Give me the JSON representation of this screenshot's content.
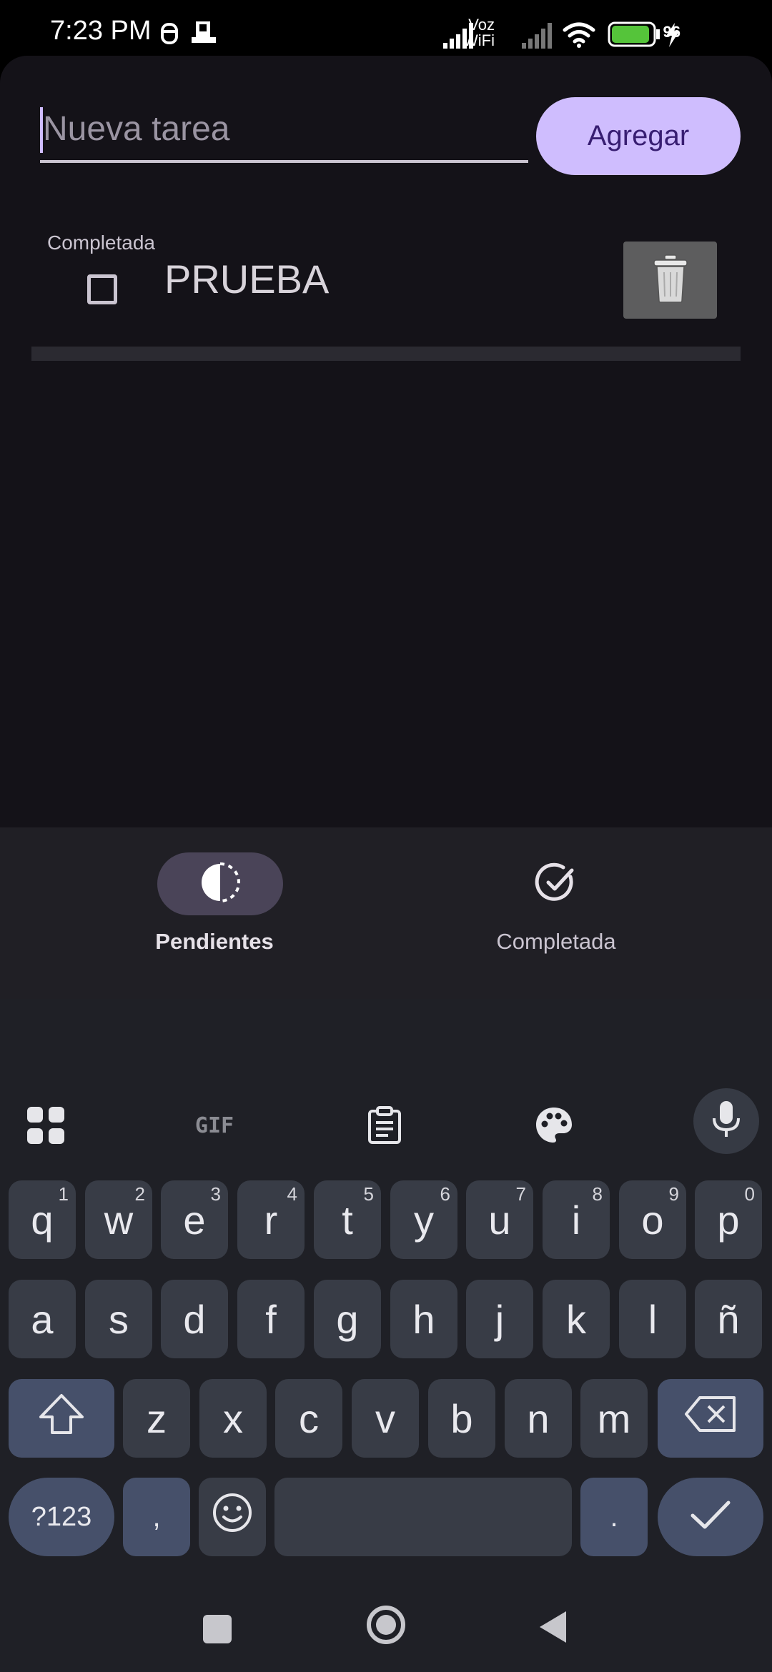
{
  "status_bar": {
    "time": "7:23 PM",
    "carrier_label_top": "Voz",
    "carrier_label_bottom": "WiFi",
    "battery": "96"
  },
  "task_input": {
    "placeholder": "Nueva tarea",
    "value": ""
  },
  "add_button": {
    "label": "Agregar"
  },
  "tasks": [
    {
      "status_label": "Completada",
      "title": "PRUEBA",
      "checked": false
    }
  ],
  "bottom_nav": {
    "items": [
      {
        "label": "Pendientes",
        "selected": true,
        "icon": "contrast-icon"
      },
      {
        "label": "Completada",
        "selected": false,
        "icon": "check-circle-icon"
      }
    ]
  },
  "keyboard": {
    "toolbar": [
      "apps-grid-icon",
      "gif-icon",
      "clipboard-icon",
      "palette-icon",
      "mic-icon"
    ],
    "gif_label": "GIF",
    "row1": [
      {
        "k": "q",
        "h": "1"
      },
      {
        "k": "w",
        "h": "2"
      },
      {
        "k": "e",
        "h": "3"
      },
      {
        "k": "r",
        "h": "4"
      },
      {
        "k": "t",
        "h": "5"
      },
      {
        "k": "y",
        "h": "6"
      },
      {
        "k": "u",
        "h": "7"
      },
      {
        "k": "i",
        "h": "8"
      },
      {
        "k": "o",
        "h": "9"
      },
      {
        "k": "p",
        "h": "0"
      }
    ],
    "row2": [
      "a",
      "s",
      "d",
      "f",
      "g",
      "h",
      "j",
      "k",
      "l",
      "ñ"
    ],
    "row3": [
      "z",
      "x",
      "c",
      "v",
      "b",
      "n",
      "m"
    ],
    "symbols_label": "?123",
    "comma_label": ",",
    "period_label": "."
  },
  "colors": {
    "background": "#141218",
    "accent": "#cfbdfe",
    "nav_pill": "#4a4458",
    "keyboard_bg": "#1f2026"
  }
}
